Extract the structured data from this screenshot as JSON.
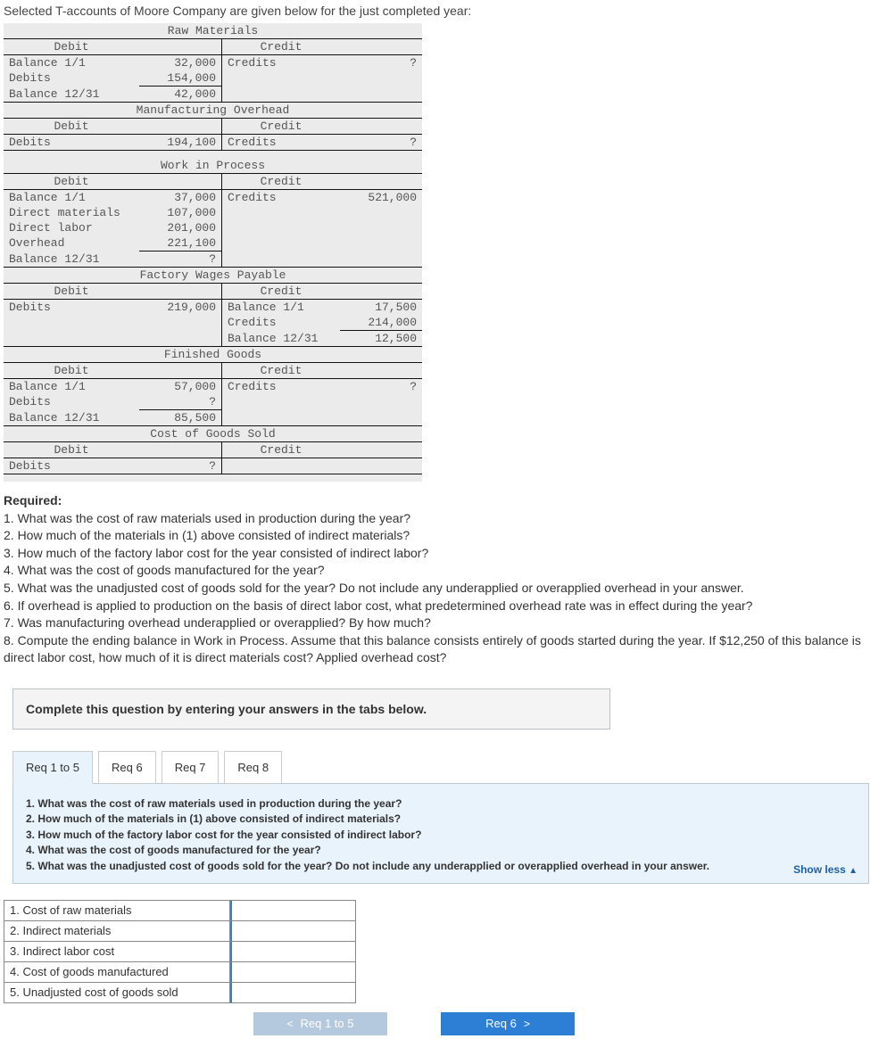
{
  "intro": "Selected T-accounts of Moore Company are given below for the just completed year:",
  "headers": {
    "debit": "Debit",
    "credit": "Credit"
  },
  "accounts": {
    "raw": {
      "title": "Raw Materials",
      "rows": [
        {
          "l": "Balance 1/1",
          "lv": "32,000",
          "m": "Credits",
          "rv": "?"
        },
        {
          "l": "Debits",
          "lv": "154,000",
          "m": "",
          "rv": ""
        }
      ],
      "bal": {
        "l": "Balance 12/31",
        "lv": "42,000"
      }
    },
    "moh": {
      "title": "Manufacturing Overhead",
      "rows": [
        {
          "l": "Debits",
          "lv": "194,100",
          "m": "Credits",
          "rv": "?"
        }
      ]
    },
    "wip": {
      "title": "Work in Process",
      "rows": [
        {
          "l": "Balance 1/1",
          "lv": "37,000",
          "m": "Credits",
          "rv": "521,000"
        },
        {
          "l": "Direct materials",
          "lv": "107,000",
          "m": "",
          "rv": ""
        },
        {
          "l": "Direct labor",
          "lv": "201,000",
          "m": "",
          "rv": ""
        },
        {
          "l": "Overhead",
          "lv": "221,100",
          "m": "",
          "rv": ""
        }
      ],
      "bal": {
        "l": "Balance 12/31",
        "lv": "?"
      }
    },
    "fwp": {
      "title": "Factory Wages Payable",
      "rows": [
        {
          "l": "Debits",
          "lv": "219,000",
          "m": "Balance 1/1",
          "rv": "17,500"
        },
        {
          "l": "",
          "lv": "",
          "m": "Credits",
          "rv": "214,000"
        },
        {
          "l": "",
          "lv": "",
          "m": "Balance 12/31",
          "rv": "12,500",
          "rbal": true
        }
      ]
    },
    "fg": {
      "title": "Finished Goods",
      "rows": [
        {
          "l": "Balance 1/1",
          "lv": "57,000",
          "m": "Credits",
          "rv": "?"
        },
        {
          "l": "Debits",
          "lv": "?",
          "m": "",
          "rv": ""
        }
      ],
      "bal": {
        "l": "Balance 12/31",
        "lv": "85,500"
      }
    },
    "cogs": {
      "title": "Cost of Goods Sold",
      "rows": [
        {
          "l": "Debits",
          "lv": "?",
          "m": "",
          "rv": ""
        }
      ]
    }
  },
  "required_label": "Required:",
  "required": [
    "1. What was the cost of raw materials used in production during the year?",
    "2. How much of the materials in (1) above consisted of indirect materials?",
    "3. How much of the factory labor cost for the year consisted of indirect labor?",
    "4. What was the cost of goods manufactured for the year?",
    "5. What was the unadjusted cost of goods sold for the year? Do not include any underapplied or overapplied overhead in your answer.",
    "6. If overhead is applied to production on the basis of direct labor cost, what predetermined overhead rate was in effect during the year?",
    "7. Was manufacturing overhead underapplied or overapplied? By how much?",
    "8. Compute the ending balance in Work in Process. Assume that this balance consists entirely of goods started during the year. If $12,250 of this balance is direct labor cost, how much of it is direct materials cost? Applied overhead cost?"
  ],
  "answer_box": "Complete this question by entering your answers in the tabs below.",
  "tabs": [
    "Req 1 to 5",
    "Req 6",
    "Req 7",
    "Req 8"
  ],
  "active_tab": 0,
  "panel_questions": [
    "1. What was the cost of raw materials used in production during the year?",
    "2. How much of the materials in (1) above consisted of indirect materials?",
    "3. How much of the factory labor cost for the year consisted of indirect labor?",
    "4. What was the cost of goods manufactured for the year?",
    "5. What was the unadjusted cost of goods sold for the year? Do not include any underapplied or overapplied overhead in your answer."
  ],
  "show_less": "Show less",
  "answer_rows": [
    "1. Cost of raw materials",
    "2. Indirect materials",
    "3. Indirect labor cost",
    "4. Cost of goods manufactured",
    "5. Unadjusted cost of goods sold"
  ],
  "nav": {
    "prev": "Req 1 to 5",
    "next": "Req 6"
  }
}
